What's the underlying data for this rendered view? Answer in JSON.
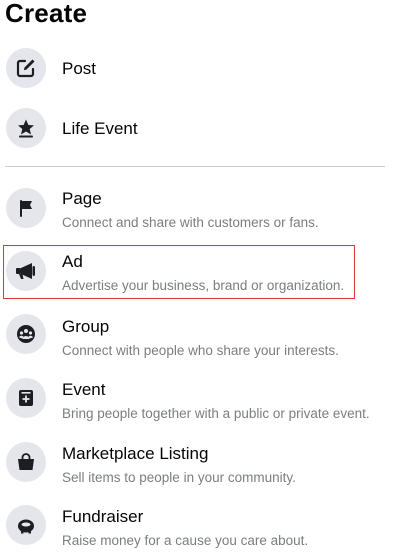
{
  "title": "Create",
  "items_top": [
    {
      "label": "Post",
      "icon": "compose-icon"
    },
    {
      "label": "Life Event",
      "icon": "star-icon"
    }
  ],
  "items_bottom": [
    {
      "label": "Page",
      "description": "Connect and share with customers or fans.",
      "icon": "flag-icon"
    },
    {
      "label": "Ad",
      "description": "Advertise your business, brand or organization.",
      "icon": "megaphone-icon",
      "highlighted": true
    },
    {
      "label": "Group",
      "description": "Connect with people who share your interests.",
      "icon": "group-icon"
    },
    {
      "label": "Event",
      "description": "Bring people together with a public or private event.",
      "icon": "calendar-plus-icon"
    },
    {
      "label": "Marketplace Listing",
      "description": "Sell items to people in your community.",
      "icon": "shopping-bag-icon"
    },
    {
      "label": "Fundraiser",
      "description": "Raise money for a cause you care about.",
      "icon": "piggy-bank-icon"
    }
  ],
  "colors": {
    "icon_bg": "#e4e6eb",
    "icon_fg": "#1c1e21",
    "text_primary": "#050505",
    "text_secondary": "#7a7d82",
    "highlight_border": "#d9363e"
  }
}
